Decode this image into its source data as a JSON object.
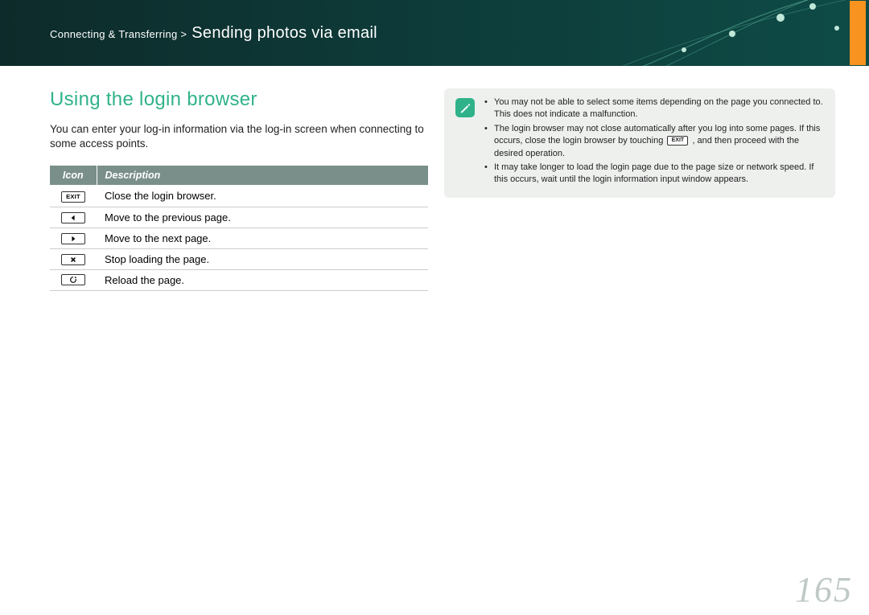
{
  "header": {
    "breadcrumb_prefix": "Connecting & Transferring > ",
    "title": "Sending photos via email"
  },
  "section": {
    "heading": "Using the login browser",
    "intro": "You can enter your log-in information via the log-in screen when connecting to some access points."
  },
  "table": {
    "col_icon": "Icon",
    "col_desc": "Description",
    "rows": [
      {
        "icon": "exit-icon",
        "icon_label": "EXIT",
        "desc": "Close the login browser."
      },
      {
        "icon": "back-icon",
        "icon_label": "",
        "desc": "Move to the previous page."
      },
      {
        "icon": "forward-icon",
        "icon_label": "",
        "desc": "Move to the next page."
      },
      {
        "icon": "stop-icon",
        "icon_label": "",
        "desc": "Stop loading the page."
      },
      {
        "icon": "reload-icon",
        "icon_label": "",
        "desc": "Reload the page."
      }
    ]
  },
  "info": {
    "bullets": [
      "You may not be able to select some items depending on the page you connected to. This does not indicate a malfunction.",
      "__EXIT__",
      "It may take longer to load the login page due to the page size or network speed. If this occurs, wait until the login information input window appears."
    ],
    "bullet2_pre": "The login browser may not close automatically after you log into some pages. If this occurs, close the login browser by touching ",
    "bullet2_exit": "EXIT",
    "bullet2_post": " , and then proceed with the desired operation."
  },
  "page_number": "165"
}
